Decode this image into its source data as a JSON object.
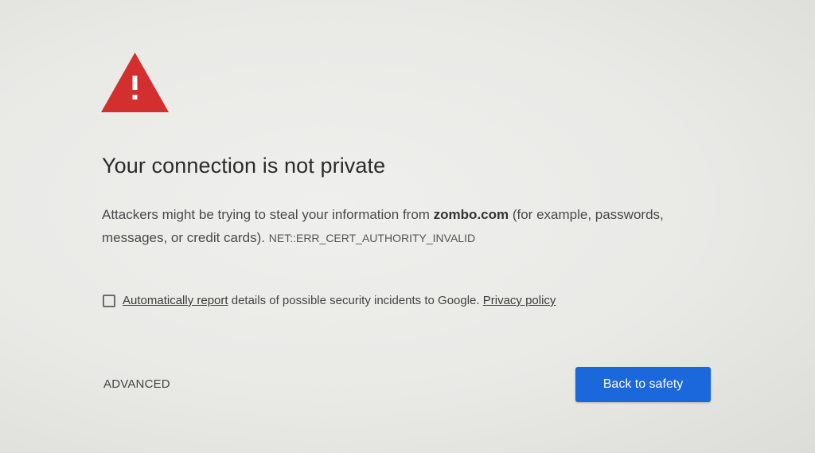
{
  "interstitial": {
    "icon": "warning-triangle-icon",
    "heading": "Your connection is not private",
    "explanation": {
      "before_domain": "Attackers might be trying to steal your information from ",
      "domain": "zombo.com",
      "after_domain": " (for example, passwords, messages, or credit cards). ",
      "error_code": "NET::ERR_CERT_AUTHORITY_INVALID"
    },
    "report": {
      "checked": false,
      "link_text": "Automatically report",
      "middle_text": " details of possible security incidents to Google. ",
      "privacy_link_text": "Privacy policy"
    },
    "advanced_label": "ADVANCED",
    "back_label": "Back to safety"
  },
  "colors": {
    "warning_red": "#d32f2f",
    "primary_blue": "#1a68dc"
  }
}
